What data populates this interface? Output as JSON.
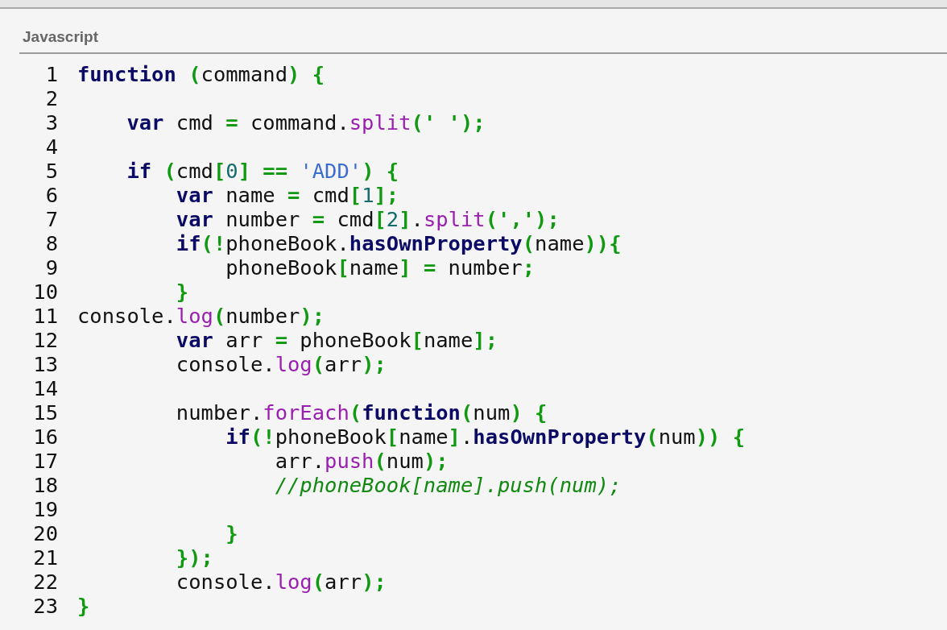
{
  "code_block": {
    "language": "Javascript",
    "lines": [
      {
        "number": "1",
        "tokens": [
          {
            "kind": "kw",
            "t": "function "
          },
          {
            "kind": "p",
            "t": "("
          },
          {
            "kind": "tx",
            "t": "command"
          },
          {
            "kind": "p",
            "t": ") {"
          }
        ]
      },
      {
        "number": "2"
      },
      {
        "number": "3",
        "tokens": [
          {
            "kind": "kw",
            "t": "    var"
          },
          {
            "kind": "tx",
            "t": " cmd "
          },
          {
            "kind": "p",
            "t": "="
          },
          {
            "kind": "tx",
            "t": " command."
          },
          {
            "kind": "fn",
            "t": "split"
          },
          {
            "kind": "p",
            "t": "(' ');"
          }
        ]
      },
      {
        "number": "4"
      },
      {
        "number": "5",
        "tokens": [
          {
            "kind": "kw",
            "t": "    if"
          },
          {
            "kind": "p",
            "t": " ("
          },
          {
            "kind": "tx",
            "t": "cmd"
          },
          {
            "kind": "p",
            "t": "["
          },
          {
            "kind": "num",
            "t": "0"
          },
          {
            "kind": "p",
            "t": "] == "
          },
          {
            "kind": "str",
            "t": "'ADD'"
          },
          {
            "kind": "p",
            "t": ") {"
          }
        ]
      },
      {
        "number": "6",
        "tokens": [
          {
            "kind": "kw",
            "t": "        var"
          },
          {
            "kind": "tx",
            "t": " name "
          },
          {
            "kind": "p",
            "t": "="
          },
          {
            "kind": "tx",
            "t": " cmd"
          },
          {
            "kind": "p",
            "t": "["
          },
          {
            "kind": "num",
            "t": "1"
          },
          {
            "kind": "p",
            "t": "];"
          }
        ]
      },
      {
        "number": "7",
        "tokens": [
          {
            "kind": "kw",
            "t": "        var"
          },
          {
            "kind": "tx",
            "t": " number "
          },
          {
            "kind": "p",
            "t": "="
          },
          {
            "kind": "tx",
            "t": " cmd"
          },
          {
            "kind": "p",
            "t": "["
          },
          {
            "kind": "num",
            "t": "2"
          },
          {
            "kind": "p",
            "t": "]"
          },
          {
            "kind": "tx",
            "t": "."
          },
          {
            "kind": "fn",
            "t": "split"
          },
          {
            "kind": "p",
            "t": "(',');"
          }
        ]
      },
      {
        "number": "8",
        "tokens": [
          {
            "kind": "kw",
            "t": "        if"
          },
          {
            "kind": "p",
            "t": "(!"
          },
          {
            "kind": "tx",
            "t": "phoneBook."
          },
          {
            "kind": "kw",
            "t": "hasOwnProperty"
          },
          {
            "kind": "p",
            "t": "("
          },
          {
            "kind": "tx",
            "t": "name"
          },
          {
            "kind": "p",
            "t": ")){"
          }
        ]
      },
      {
        "number": "9",
        "tokens": [
          {
            "kind": "tx",
            "t": "            phoneBook"
          },
          {
            "kind": "p",
            "t": "["
          },
          {
            "kind": "tx",
            "t": "name"
          },
          {
            "kind": "p",
            "t": "] ="
          },
          {
            "kind": "tx",
            "t": " number"
          },
          {
            "kind": "p",
            "t": ";"
          }
        ]
      },
      {
        "number": "10",
        "tokens": [
          {
            "kind": "p",
            "t": "        }"
          }
        ]
      },
      {
        "number": "11",
        "tokens": [
          {
            "kind": "tx",
            "t": "console."
          },
          {
            "kind": "fn",
            "t": "log"
          },
          {
            "kind": "p",
            "t": "("
          },
          {
            "kind": "tx",
            "t": "number"
          },
          {
            "kind": "p",
            "t": ");"
          }
        ]
      },
      {
        "number": "12",
        "tokens": [
          {
            "kind": "kw",
            "t": "        var"
          },
          {
            "kind": "tx",
            "t": " arr "
          },
          {
            "kind": "p",
            "t": "="
          },
          {
            "kind": "tx",
            "t": " phoneBook"
          },
          {
            "kind": "p",
            "t": "["
          },
          {
            "kind": "tx",
            "t": "name"
          },
          {
            "kind": "p",
            "t": "];"
          }
        ]
      },
      {
        "number": "13",
        "tokens": [
          {
            "kind": "tx",
            "t": "        console."
          },
          {
            "kind": "fn",
            "t": "log"
          },
          {
            "kind": "p",
            "t": "("
          },
          {
            "kind": "tx",
            "t": "arr"
          },
          {
            "kind": "p",
            "t": ");"
          }
        ]
      },
      {
        "number": "14"
      },
      {
        "number": "15",
        "tokens": [
          {
            "kind": "tx",
            "t": "        number."
          },
          {
            "kind": "fn",
            "t": "forEach"
          },
          {
            "kind": "p",
            "t": "("
          },
          {
            "kind": "kw",
            "t": "function"
          },
          {
            "kind": "p",
            "t": "("
          },
          {
            "kind": "tx",
            "t": "num"
          },
          {
            "kind": "p",
            "t": ") {"
          }
        ]
      },
      {
        "number": "16",
        "tokens": [
          {
            "kind": "kw",
            "t": "            if"
          },
          {
            "kind": "p",
            "t": "(!"
          },
          {
            "kind": "tx",
            "t": "phoneBook"
          },
          {
            "kind": "p",
            "t": "["
          },
          {
            "kind": "tx",
            "t": "name"
          },
          {
            "kind": "p",
            "t": "]"
          },
          {
            "kind": "tx",
            "t": "."
          },
          {
            "kind": "kw",
            "t": "hasOwnProperty"
          },
          {
            "kind": "p",
            "t": "("
          },
          {
            "kind": "tx",
            "t": "num"
          },
          {
            "kind": "p",
            "t": ")) {"
          }
        ]
      },
      {
        "number": "17",
        "tokens": [
          {
            "kind": "tx",
            "t": "                arr."
          },
          {
            "kind": "fn",
            "t": "push"
          },
          {
            "kind": "p",
            "t": "("
          },
          {
            "kind": "tx",
            "t": "num"
          },
          {
            "kind": "p",
            "t": ");"
          }
        ]
      },
      {
        "number": "18",
        "tokens": [
          {
            "kind": "cm",
            "t": "                //phoneBook[name].push(num);"
          }
        ]
      },
      {
        "number": "19"
      },
      {
        "number": "20",
        "tokens": [
          {
            "kind": "p",
            "t": "            }"
          }
        ]
      },
      {
        "number": "21",
        "tokens": [
          {
            "kind": "p",
            "t": "        });"
          }
        ]
      },
      {
        "number": "22",
        "tokens": [
          {
            "kind": "tx",
            "t": "        console."
          },
          {
            "kind": "fn",
            "t": "log"
          },
          {
            "kind": "p",
            "t": "("
          },
          {
            "kind": "tx",
            "t": "arr"
          },
          {
            "kind": "p",
            "t": ");"
          }
        ]
      },
      {
        "number": "23",
        "tokens": [
          {
            "kind": "p",
            "t": "}"
          }
        ]
      }
    ]
  }
}
